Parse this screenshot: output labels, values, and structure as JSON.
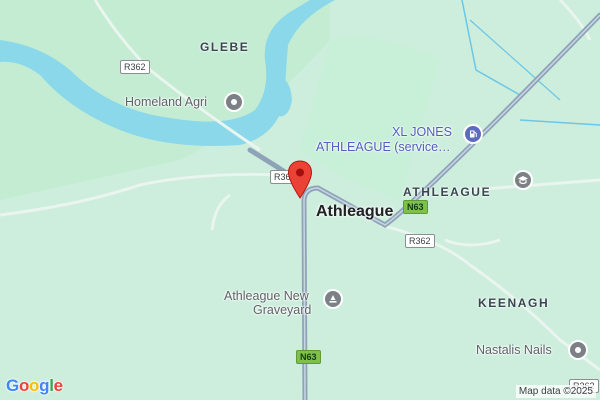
{
  "map": {
    "colors": {
      "land": "#cdeedd",
      "forest": "#bfe8cd",
      "water": "#8ad8ea",
      "road_main": "#7f95ad",
      "road_minor": "#ffffff",
      "pin": "#ea4335"
    },
    "area_labels": {
      "glebe": "GLEBE",
      "athleague_area": "ATHLEAGUE",
      "keenagh": "KEENAGH"
    },
    "town_label": "Athleague",
    "pois": {
      "homeland_agri": {
        "label": "Homeland Agri",
        "icon": "pin-circle-icon"
      },
      "xl_jones_line1": "XL JONES",
      "xl_jones_line2": "ATHLEAGUE (service…",
      "xl_jones_icon": "gas-station-icon",
      "graveyard_line1": "Athleague New",
      "graveyard_line2": "Graveyard",
      "graveyard_icon": "cemetery-icon",
      "school_icon": "school-icon",
      "nastalis": {
        "label": "Nastalis Nails",
        "icon": "pin-circle-icon"
      }
    },
    "road_shields": {
      "r362_top": "R362",
      "r362_left": "R36",
      "n63_east": "N63",
      "r362_mid": "R362",
      "n63_south": "N63",
      "r362_bottom": "R362"
    },
    "branding": {
      "logo_letters": [
        "G",
        "o",
        "o",
        "g",
        "l",
        "e"
      ],
      "logo_colors": [
        "#4285f4",
        "#ea4335",
        "#fbbc05",
        "#4285f4",
        "#34a853",
        "#ea4335"
      ],
      "attribution": "Map data ©2025"
    }
  }
}
